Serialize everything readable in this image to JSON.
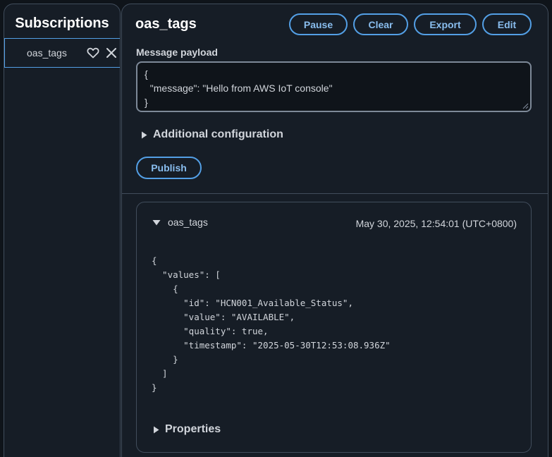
{
  "left": {
    "title": "Subscriptions",
    "items": [
      {
        "label": "oas_tags"
      }
    ]
  },
  "right": {
    "topic_title": "oas_tags",
    "buttons": {
      "pause": "Pause",
      "clear": "Clear",
      "export": "Export",
      "edit": "Edit"
    },
    "payload_label": "Message payload",
    "payload_value": "{\n  \"message\": \"Hello from AWS IoT console\"\n}",
    "additional_config": "Additional configuration",
    "publish": "Publish",
    "message": {
      "topic": "oas_tags",
      "timestamp": "May 30, 2025, 12:54:01 (UTC+0800)",
      "body": "{\n  \"values\": [\n    {\n      \"id\": \"HCN001_Available_Status\",\n      \"value\": \"AVAILABLE\",\n      \"quality\": true,\n      \"timestamp\": \"2025-05-30T12:53:08.936Z\"\n    }\n  ]\n}",
      "properties": "Properties"
    }
  },
  "colors": {
    "background": "#0f141a",
    "panel": "#161d26",
    "border": "#414d5c",
    "accent": "#539fe5",
    "accent_text": "#89bdee"
  }
}
